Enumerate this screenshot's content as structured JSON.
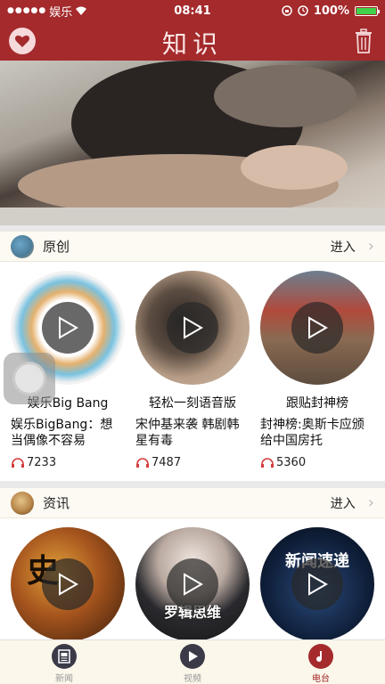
{
  "status": {
    "carrier": "娱乐",
    "time": "08:41",
    "battery": "100%",
    "battery_level": 1.0
  },
  "nav": {
    "title": "知识",
    "left_icon": "heart-icon",
    "right_icon": "trash-icon"
  },
  "sections": [
    {
      "title": "原创",
      "enter": "进入",
      "items": [
        {
          "name": "娱乐Big Bang",
          "desc": "娱乐BigBang：想当偶像不容易",
          "count": "7233"
        },
        {
          "name": "轻松一刻语音版",
          "desc": "宋仲基来袭 韩剧韩星有毒",
          "count": "7487"
        },
        {
          "name": "跟贴封神榜",
          "desc": "封神榜:奥斯卡应颁给中国房托",
          "count": "5360"
        }
      ]
    },
    {
      "title": "资讯",
      "enter": "进入",
      "items": [
        {
          "art_text": "史"
        },
        {
          "art_text": "罗辑思维"
        },
        {
          "art_text": "新闻速递"
        }
      ]
    }
  ],
  "tabs": [
    {
      "label": "新闻",
      "icon": "news-icon",
      "active": false
    },
    {
      "label": "视频",
      "icon": "video-icon",
      "active": false
    },
    {
      "label": "电台",
      "icon": "radio-icon",
      "active": true
    }
  ],
  "colors": {
    "brand": "#a42a2c",
    "tab_bg": "#fbf7ea"
  }
}
